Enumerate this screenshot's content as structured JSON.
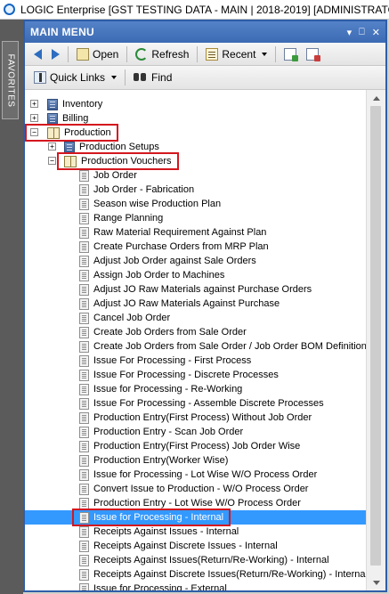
{
  "window": {
    "title": "LOGIC Enterprise [GST TESTING DATA - MAIN | 2018-2019] [ADMINISTRATOR]"
  },
  "sidebar": {
    "favorites_label": "FAVORITES"
  },
  "menu": {
    "title": "MAIN MENU",
    "header_controls": [
      "▾",
      "⎕",
      "✕"
    ]
  },
  "toolbar": {
    "open_label": "Open",
    "refresh_label": "Refresh",
    "recent_label": "Recent"
  },
  "toolbar2": {
    "quick_links_label": "Quick Links",
    "find_label": "Find"
  },
  "tree": {
    "nodes": [
      {
        "label": "Inventory",
        "level": 0,
        "expander": "+",
        "icon": "folder-icon",
        "highlighted": false,
        "selected": false
      },
      {
        "label": "Billing",
        "level": 0,
        "expander": "+",
        "icon": "folder-icon",
        "highlighted": false,
        "selected": false
      },
      {
        "label": "Production",
        "level": 0,
        "expander": "−",
        "icon": "book-icon",
        "highlighted": true,
        "selected": false
      },
      {
        "label": "Production Setups",
        "level": 1,
        "expander": "+",
        "icon": "folder-icon",
        "highlighted": false,
        "selected": false
      },
      {
        "label": "Production Vouchers",
        "level": 1,
        "expander": "−",
        "icon": "book-icon",
        "highlighted": true,
        "selected": false
      },
      {
        "label": "Job Order",
        "level": 2,
        "expander": "",
        "icon": "doc-icon",
        "highlighted": false,
        "selected": false
      },
      {
        "label": "Job Order - Fabrication",
        "level": 2,
        "expander": "",
        "icon": "doc-icon",
        "highlighted": false,
        "selected": false
      },
      {
        "label": "Season wise Production Plan",
        "level": 2,
        "expander": "",
        "icon": "doc-icon",
        "highlighted": false,
        "selected": false
      },
      {
        "label": "Range Planning",
        "level": 2,
        "expander": "",
        "icon": "doc-icon",
        "highlighted": false,
        "selected": false
      },
      {
        "label": "Raw Material Requirement Against Plan",
        "level": 2,
        "expander": "",
        "icon": "doc-icon",
        "highlighted": false,
        "selected": false
      },
      {
        "label": "Create Purchase Orders from MRP Plan",
        "level": 2,
        "expander": "",
        "icon": "doc-icon",
        "highlighted": false,
        "selected": false
      },
      {
        "label": "Adjust Job Order against Sale Orders",
        "level": 2,
        "expander": "",
        "icon": "doc-icon",
        "highlighted": false,
        "selected": false
      },
      {
        "label": "Assign Job Order to Machines",
        "level": 2,
        "expander": "",
        "icon": "doc-icon",
        "highlighted": false,
        "selected": false
      },
      {
        "label": "Adjust JO Raw Materials against Purchase Orders",
        "level": 2,
        "expander": "",
        "icon": "doc-icon",
        "highlighted": false,
        "selected": false
      },
      {
        "label": "Adjust JO Raw Materials Against Purchase",
        "level": 2,
        "expander": "",
        "icon": "doc-icon",
        "highlighted": false,
        "selected": false
      },
      {
        "label": "Cancel Job Order",
        "level": 2,
        "expander": "",
        "icon": "doc-icon",
        "highlighted": false,
        "selected": false
      },
      {
        "label": "Create Job Orders from Sale Order",
        "level": 2,
        "expander": "",
        "icon": "doc-icon",
        "highlighted": false,
        "selected": false
      },
      {
        "label": "Create Job Orders from Sale Order / Job Order BOM Definition",
        "level": 2,
        "expander": "",
        "icon": "doc-icon",
        "highlighted": false,
        "selected": false
      },
      {
        "label": "Issue For Processing - First Process",
        "level": 2,
        "expander": "",
        "icon": "doc-icon",
        "highlighted": false,
        "selected": false
      },
      {
        "label": "Issue For Processing - Discrete Processes",
        "level": 2,
        "expander": "",
        "icon": "doc-icon",
        "highlighted": false,
        "selected": false
      },
      {
        "label": "Issue for Processing - Re-Working",
        "level": 2,
        "expander": "",
        "icon": "doc-icon",
        "highlighted": false,
        "selected": false
      },
      {
        "label": "Issue For Processing - Assemble Discrete Processes",
        "level": 2,
        "expander": "",
        "icon": "doc-icon",
        "highlighted": false,
        "selected": false
      },
      {
        "label": "Production Entry(First Process) Without Job Order",
        "level": 2,
        "expander": "",
        "icon": "doc-icon",
        "highlighted": false,
        "selected": false
      },
      {
        "label": "Production Entry - Scan Job Order",
        "level": 2,
        "expander": "",
        "icon": "doc-icon",
        "highlighted": false,
        "selected": false
      },
      {
        "label": "Production Entry(First Process) Job Order Wise",
        "level": 2,
        "expander": "",
        "icon": "doc-icon",
        "highlighted": false,
        "selected": false
      },
      {
        "label": "Production Entry(Worker Wise)",
        "level": 2,
        "expander": "",
        "icon": "doc-icon",
        "highlighted": false,
        "selected": false
      },
      {
        "label": "Issue for Processing - Lot Wise W/O Process Order",
        "level": 2,
        "expander": "",
        "icon": "doc-icon",
        "highlighted": false,
        "selected": false
      },
      {
        "label": "Convert Issue to Production - W/O Process Order",
        "level": 2,
        "expander": "",
        "icon": "doc-icon",
        "highlighted": false,
        "selected": false
      },
      {
        "label": "Production Entry - Lot Wise W/O Process Order",
        "level": 2,
        "expander": "",
        "icon": "doc-icon",
        "highlighted": false,
        "selected": false
      },
      {
        "label": "Issue for Processing - Internal",
        "level": 2,
        "expander": "",
        "icon": "doc-icon",
        "highlighted": true,
        "selected": true
      },
      {
        "label": "Receipts Against Issues - Internal",
        "level": 2,
        "expander": "",
        "icon": "doc-icon",
        "highlighted": false,
        "selected": false
      },
      {
        "label": "Receipts Against Discrete Issues - Internal",
        "level": 2,
        "expander": "",
        "icon": "doc-icon",
        "highlighted": false,
        "selected": false
      },
      {
        "label": "Receipts Against Issues(Return/Re-Working) - Internal",
        "level": 2,
        "expander": "",
        "icon": "doc-icon",
        "highlighted": false,
        "selected": false
      },
      {
        "label": "Receipts Against Discrete Issues(Return/Re-Working) - Internal",
        "level": 2,
        "expander": "",
        "icon": "doc-icon",
        "highlighted": false,
        "selected": false
      },
      {
        "label": "Issue for Processing - External",
        "level": 2,
        "expander": "",
        "icon": "doc-icon",
        "highlighted": false,
        "selected": false
      }
    ]
  }
}
